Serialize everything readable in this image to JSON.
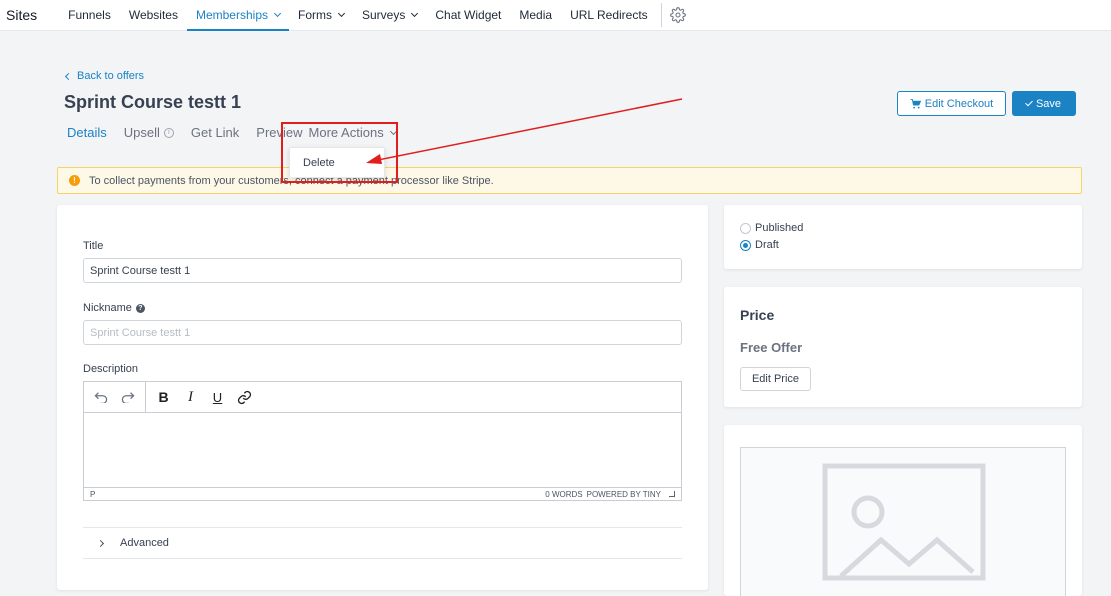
{
  "nav": {
    "brand": "Sites",
    "items": [
      {
        "label": "Funnels",
        "dropdown": false
      },
      {
        "label": "Websites",
        "dropdown": false
      },
      {
        "label": "Memberships",
        "dropdown": true,
        "active": true
      },
      {
        "label": "Forms",
        "dropdown": true
      },
      {
        "label": "Surveys",
        "dropdown": true
      },
      {
        "label": "Chat Widget",
        "dropdown": false
      },
      {
        "label": "Media",
        "dropdown": false
      },
      {
        "label": "URL Redirects",
        "dropdown": false
      }
    ]
  },
  "header": {
    "back_label": "Back to offers",
    "title": "Sprint Course testt 1",
    "edit_checkout_label": "Edit Checkout",
    "save_label": "Save"
  },
  "tabs": {
    "details": "Details",
    "upsell": "Upsell",
    "get_link": "Get Link",
    "preview": "Preview",
    "more_actions": "More Actions"
  },
  "dropdown": {
    "delete": "Delete"
  },
  "alert": {
    "text": "To collect payments from your customers, connect a payment processor like Stripe."
  },
  "form": {
    "title_label": "Title",
    "title_value": "Sprint Course testt 1",
    "nickname_label": "Nickname",
    "nickname_placeholder": "Sprint Course testt 1",
    "description_label": "Description",
    "editor_path": "P",
    "word_count": "0 WORDS",
    "powered_by": "POWERED BY TINY",
    "advanced_label": "Advanced"
  },
  "status": {
    "published_label": "Published",
    "draft_label": "Draft",
    "selected": "Draft"
  },
  "price": {
    "heading": "Price",
    "value": "Free Offer",
    "edit_label": "Edit Price"
  },
  "colors": {
    "accent": "#1b82c4",
    "annotation_red": "#e11d1d",
    "alert_bg": "#fef9e7"
  }
}
